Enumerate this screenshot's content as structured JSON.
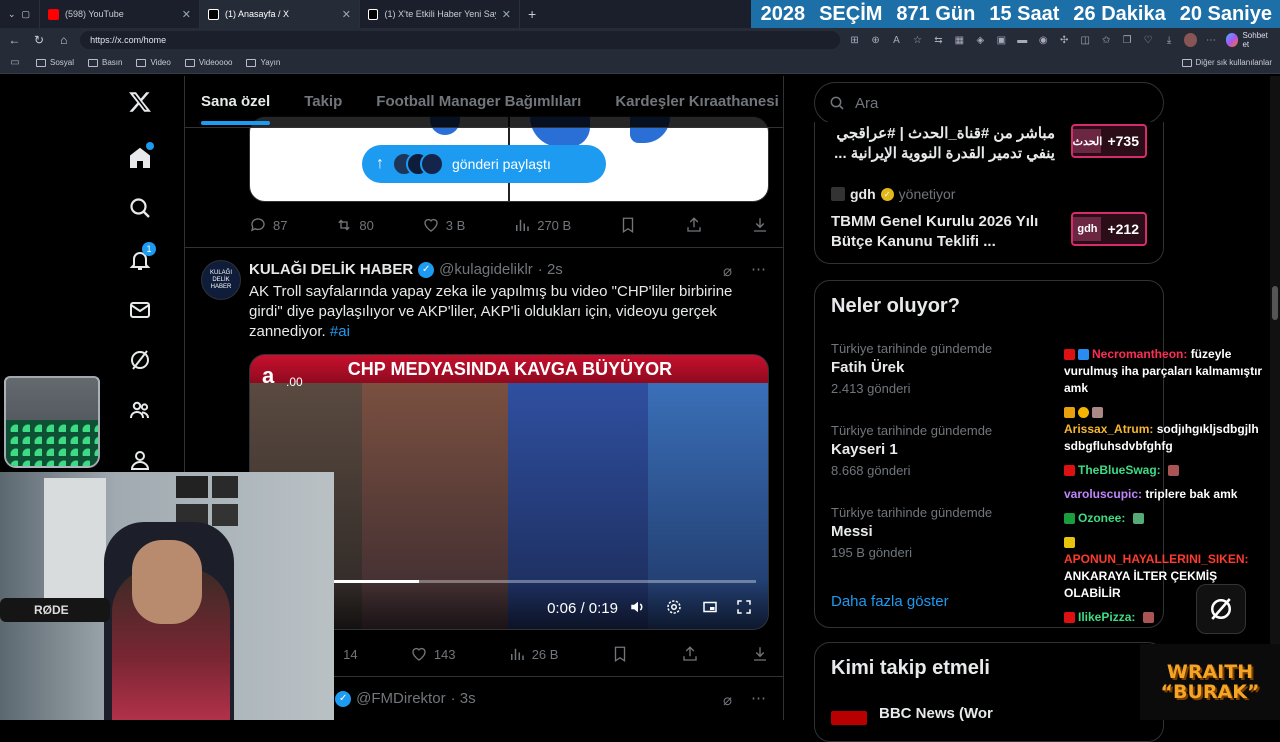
{
  "browser": {
    "tabs": [
      {
        "label": "(598) YouTube",
        "color": "#ff0000"
      },
      {
        "label": "(1) Anasayfa / X",
        "color": "#ffffff"
      },
      {
        "label": "(1) X'te Etkili Haber Yeni Sayfa: \"Y...",
        "color": "#ffffff"
      }
    ],
    "new_tab": "+",
    "url": "https://x.com/home",
    "copilot_label": "Sohbet et",
    "bookmarks": [
      "Sosyal",
      "Basın",
      "Video",
      "Videoooo",
      "Yayın"
    ],
    "bookmarks_other": "Diğer sık kullanılanlar"
  },
  "countdown": {
    "year": "2028",
    "label": "SEÇİM",
    "days": "871 Gün",
    "hours": "15 Saat",
    "minutes": "26 Dakika",
    "seconds": "20 Saniye",
    "bg_color": "#1d6fa8"
  },
  "nav": {
    "notifications_count": "1"
  },
  "feed": {
    "tabs": [
      "Sana özel",
      "Takip",
      "Football Manager Bağımlıları",
      "Kardeşler Kıraathanesi"
    ],
    "post1": {
      "share_pill": "gönderi paylaştı",
      "replies": "87",
      "reposts": "80",
      "likes": "3 B",
      "views": "270 B"
    },
    "post2": {
      "avatar_text": "KULAĞI DELİK HABER",
      "author": "KULAĞI DELİK HABER",
      "handle": "@kulagideliklr",
      "time": "· 2s",
      "text": "AK Troll sayfalarında yapay zeka ile yapılmış bu video \"CHP'liler birbirine girdi\" diye paylaşılıyor ve AKP'liler, AKP'li oldukları için, videoyu gerçek zannediyor.",
      "hashtag": "#ai",
      "video": {
        "banner": "CHP MEDYASINDA KAVGA BÜYÜYOR",
        "logo": "a",
        "timecode": ".00",
        "time": "0:06 / 0:19",
        "progress": 0.316
      },
      "reposts": "14",
      "likes": "143",
      "views": "26 B"
    },
    "post3": {
      "author_fragment": "n",
      "handle": "@FMDirektor",
      "time": "· 3s"
    }
  },
  "sidebar": {
    "search_placeholder": "Ara",
    "news": [
      {
        "title": "مباشر من #قناة_الحدث | #عراقجي ينفي تدمير القدرة النووية الإيرانية ...",
        "badge_logo": "الحدث",
        "badge_count": "+735"
      },
      {
        "source": "gdh",
        "source_role": "yönetiyor",
        "title": "TBMM Genel Kurulu 2026 Yılı Bütçe Kanunu Teklifi ...",
        "badge_logo": "gdh",
        "badge_count": "+212"
      }
    ],
    "whats_happening": {
      "title": "Neler oluyor?",
      "trends": [
        {
          "context": "Türkiye tarihinde gündemde",
          "name": "Fatih Ürek",
          "count": "2.413 gönderi"
        },
        {
          "context": "Türkiye tarihinde gündemde",
          "name": "Kayseri 1",
          "count": "8.668 gönderi"
        },
        {
          "context": "Türkiye tarihinde gündemde",
          "name": "Messi",
          "count": "195 B gönderi"
        }
      ],
      "show_more": "Daha fazla göster"
    },
    "who_to_follow": {
      "title": "Kimi takip etmeli",
      "first": "BBC News (Wor"
    }
  },
  "chat": [
    {
      "user": "Necromantheon:",
      "user_color": "#ff2d55",
      "msg": "füzeyle vurulmuş iha parçaları kalmamıştır amk"
    },
    {
      "user": "Arissax_Atrum:",
      "user_color": "#f7b731",
      "msg": "sodjıhgıkljsdbgjlh sdbgfluhsdvbfghfg"
    },
    {
      "user": "TheBlueSwag:",
      "user_color": "#3ddc84",
      "msg": ""
    },
    {
      "user": "varoluscupic:",
      "user_color": "#c084fc",
      "msg": "triplere bak amk"
    },
    {
      "user": "Ozonee:",
      "user_color": "#3ddc84",
      "msg": ""
    },
    {
      "user": "APONUN_HAYALLERINI_SIKEN:",
      "user_color": "#ff3b30",
      "msg": "ANKARAYA İLTER ÇEKMİŞ OLABİLİR"
    },
    {
      "user": "IlikePizza:",
      "user_color": "#3ddc84",
      "msg": ""
    }
  ],
  "overlay": {
    "wraith_line1": "WRAITH",
    "wraith_line2": "“BURAK”"
  }
}
